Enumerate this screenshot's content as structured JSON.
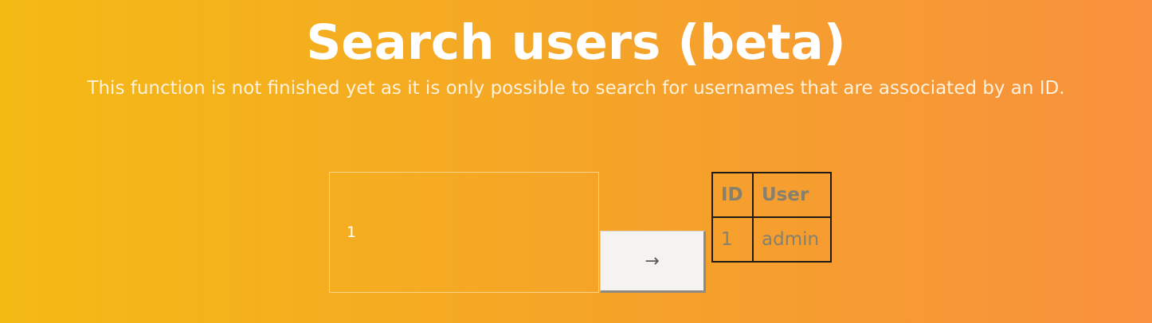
{
  "header": {
    "title": "Search users (beta)",
    "subtitle": "This function is not finished yet as it is only possible to search for usernames that are associated by an ID."
  },
  "search": {
    "value": "1",
    "submit_label": "→"
  },
  "results": {
    "columns": [
      "ID",
      "User"
    ],
    "rows": [
      [
        "1",
        "admin"
      ]
    ]
  }
}
